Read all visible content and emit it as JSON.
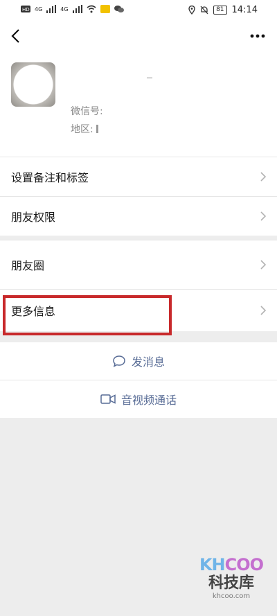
{
  "status_bar": {
    "left_icons": [
      "hd-icon",
      "signal-icon",
      "signal-icon",
      "wifi-icon",
      "notification-icon",
      "wechat-icon"
    ],
    "signal_label_1": "4G",
    "signal_label_2": "4G",
    "battery": "81",
    "time": "14:14"
  },
  "profile": {
    "wechat_id_label": "微信号:",
    "region_label": "地区:"
  },
  "menu_group_1": [
    {
      "label": "设置备注和标签"
    },
    {
      "label": "朋友权限"
    }
  ],
  "menu_group_2": [
    {
      "label": "朋友圈"
    },
    {
      "label": "更多信息"
    }
  ],
  "actions": {
    "send_message": "发消息",
    "video_call": "音视频通话"
  },
  "watermark": {
    "logo_a": "KH",
    "logo_b": "COO",
    "cn": "科技库",
    "url": "khcoo.com"
  },
  "colors": {
    "accent_link": "#576b95",
    "highlight_border": "#c8292b",
    "background": "#ededed"
  }
}
